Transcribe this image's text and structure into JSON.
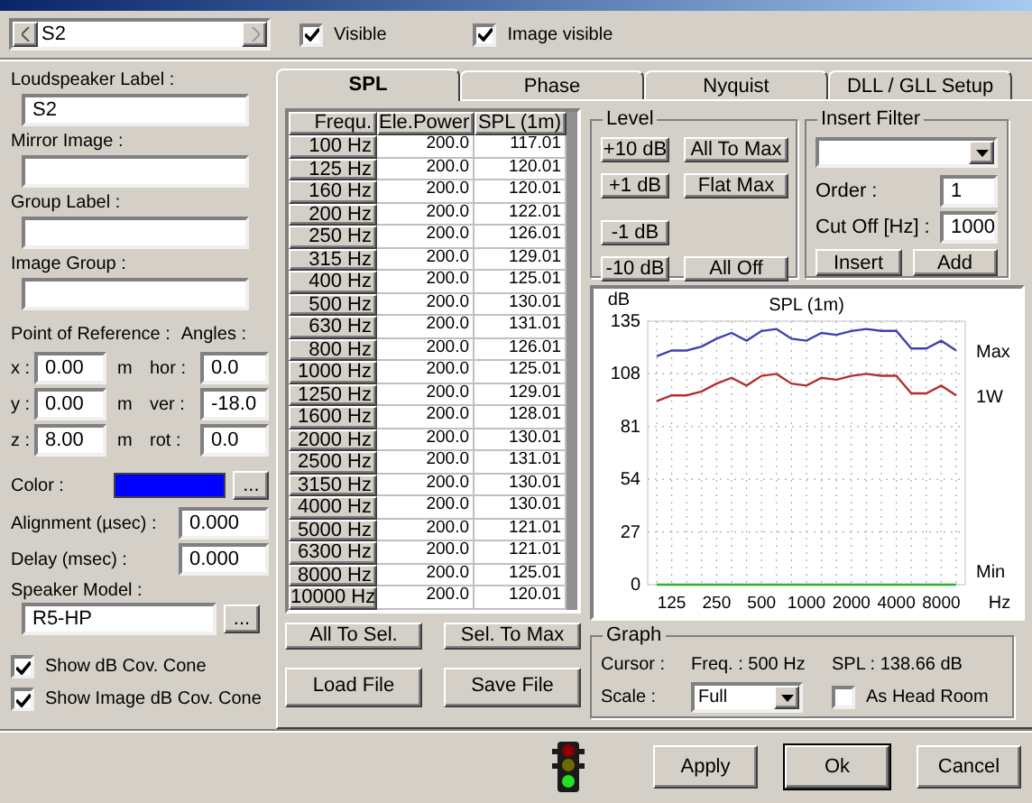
{
  "toolbar": {
    "speaker": "S2",
    "visible": {
      "label": "Visible",
      "checked": true
    },
    "image_visible": {
      "label": "Image visible",
      "checked": true
    }
  },
  "left": {
    "fields": [
      {
        "label": "Loudspeaker Label :",
        "value": "S2"
      },
      {
        "label": "Mirror Image :"
      },
      {
        "label": "Group Label :"
      },
      {
        "label": "Image Group :"
      }
    ],
    "reference_label": "Point of Reference :",
    "angles_label": "Angles :",
    "coords": [
      {
        "label": "x :",
        "value": "0.00",
        "unit": "m",
        "angle_label": "hor :",
        "angle_value": "0.0"
      },
      {
        "label": "y :",
        "value": "0.00",
        "unit": "m",
        "angle_label": "ver :",
        "angle_value": "-18.0"
      },
      {
        "label": "z :",
        "value": "8.00",
        "unit": "m",
        "angle_label": "rot :",
        "angle_value": "0.0"
      }
    ],
    "color": {
      "label": "Color :",
      "color": "#0000ff",
      "button": "..."
    },
    "alignment": {
      "label": "Alignment (µsec) :",
      "value": "0.000"
    },
    "delay": {
      "label": "Delay (msec) :",
      "value": "0.000"
    },
    "speaker_model": {
      "label": "Speaker Model :",
      "value": "R5-HP",
      "button": "..."
    },
    "checkboxes": [
      {
        "label": "Show dB Cov. Cone",
        "checked": true
      },
      {
        "label": "Show Image dB Cov. Cone",
        "checked": true
      }
    ]
  },
  "tabs": [
    {
      "label": "SPL",
      "selected": true
    },
    {
      "label": "Phase",
      "selected": false
    },
    {
      "label": "Nyquist",
      "selected": false
    },
    {
      "label": "DLL / GLL Setup",
      "selected": false
    }
  ],
  "table": {
    "columns": [
      "Frequ.",
      "Ele.Power",
      "SPL (1m)"
    ],
    "rows": [
      [
        "100 Hz",
        "200.0",
        "117.01"
      ],
      [
        "125 Hz",
        "200.0",
        "120.01"
      ],
      [
        "160 Hz",
        "200.0",
        "120.01"
      ],
      [
        "200 Hz",
        "200.0",
        "122.01"
      ],
      [
        "250 Hz",
        "200.0",
        "126.01"
      ],
      [
        "315 Hz",
        "200.0",
        "129.01"
      ],
      [
        "400 Hz",
        "200.0",
        "125.01"
      ],
      [
        "500 Hz",
        "200.0",
        "130.01"
      ],
      [
        "630 Hz",
        "200.0",
        "131.01"
      ],
      [
        "800 Hz",
        "200.0",
        "126.01"
      ],
      [
        "1000 Hz",
        "200.0",
        "125.01"
      ],
      [
        "1250 Hz",
        "200.0",
        "129.01"
      ],
      [
        "1600 Hz",
        "200.0",
        "128.01"
      ],
      [
        "2000 Hz",
        "200.0",
        "130.01"
      ],
      [
        "2500 Hz",
        "200.0",
        "131.01"
      ],
      [
        "3150 Hz",
        "200.0",
        "130.01"
      ],
      [
        "4000 Hz",
        "200.0",
        "130.01"
      ],
      [
        "5000 Hz",
        "200.0",
        "121.01"
      ],
      [
        "6300 Hz",
        "200.0",
        "121.01"
      ],
      [
        "8000 Hz",
        "200.0",
        "125.01"
      ],
      [
        "10000 Hz",
        "200.0",
        "120.01"
      ]
    ]
  },
  "table_buttons": [
    "All To Sel.",
    "Sel. To Max",
    "Load File",
    "Save File"
  ],
  "level": {
    "title": "Level",
    "buttons": [
      "+10 dB",
      "All To Max",
      "+1 dB",
      "Flat Max",
      "-1 dB",
      "-10 dB",
      "All Off"
    ]
  },
  "insert_filter": {
    "title": "Insert Filter",
    "order_label": "Order :",
    "order": "1",
    "cutoff_label": "Cut Off [Hz] :",
    "cutoff": "1000",
    "buttons": [
      "Insert",
      "Add"
    ]
  },
  "chart_data": {
    "type": "line",
    "title": "SPL (1m)",
    "xlabel": "Hz",
    "ylabel": "dB",
    "categories": [
      null,
      "125",
      null,
      null,
      "250",
      null,
      null,
      "500",
      null,
      null,
      "1000",
      null,
      null,
      "2000",
      null,
      null,
      "4000",
      null,
      null,
      "8000",
      null
    ],
    "ylim": [
      0,
      135
    ],
    "yticks": [
      0,
      27,
      54,
      81,
      108,
      135
    ],
    "grid": true,
    "series": [
      {
        "name": "Max",
        "color": "#4040b0",
        "values": [
          117,
          120,
          120,
          122,
          126,
          129,
          125,
          130,
          131,
          126,
          125,
          129,
          128,
          130,
          131,
          130,
          130,
          121,
          121,
          125,
          120
        ]
      },
      {
        "name": "1W",
        "color": "#b03030",
        "values": [
          94,
          97,
          97,
          99,
          103,
          106,
          102,
          107,
          108,
          103,
          102,
          106,
          105,
          107,
          108,
          107,
          107,
          98,
          98,
          102,
          97
        ]
      },
      {
        "name": "Min",
        "color": "#30b030",
        "values": [
          0,
          0,
          0,
          0,
          0,
          0,
          0,
          0,
          0,
          0,
          0,
          0,
          0,
          0,
          0,
          0,
          0,
          0,
          0,
          0,
          0
        ]
      }
    ]
  },
  "graph": {
    "title": "Graph",
    "cursor_label": "Cursor :",
    "freq": "Freq. : 500 Hz",
    "spl": "SPL : 138.66 dB",
    "scale_label": "Scale :",
    "scale": "Full",
    "head_room": {
      "label": "As Head Room",
      "checked": false
    }
  },
  "footer": {
    "buttons": [
      {
        "label": "Apply",
        "default": false
      },
      {
        "label": "Ok",
        "default": true
      },
      {
        "label": "Cancel",
        "default": false
      }
    ]
  }
}
